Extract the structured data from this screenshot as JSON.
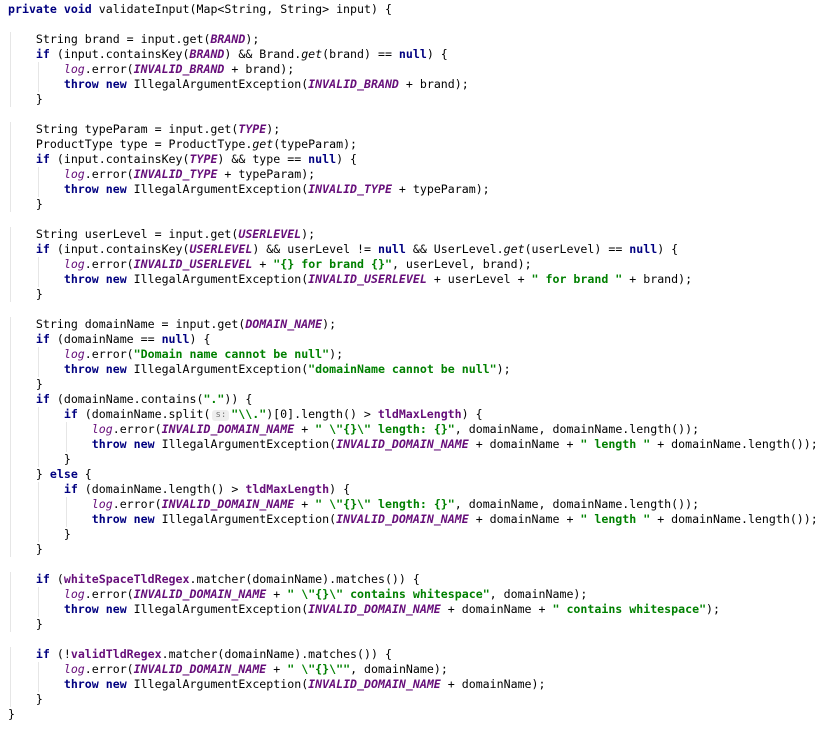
{
  "editor": {
    "lines": [
      {
        "indent": 0,
        "tokens": [
          [
            "kw",
            "private"
          ],
          [
            "t",
            " "
          ],
          [
            "kw",
            "void"
          ],
          [
            "t",
            " validateInput(Map<String, String> input) {"
          ]
        ]
      },
      {
        "indent": 0,
        "tokens": []
      },
      {
        "indent": 1,
        "tokens": [
          [
            "t",
            "String brand = input.get("
          ],
          [
            "fld",
            "BRAND"
          ],
          [
            "t",
            ");"
          ]
        ]
      },
      {
        "indent": 1,
        "tokens": [
          [
            "kw",
            "if"
          ],
          [
            "t",
            " (input.containsKey("
          ],
          [
            "fld",
            "BRAND"
          ],
          [
            "t",
            ") && Brand."
          ],
          [
            "smeth",
            "get"
          ],
          [
            "t",
            "(brand) == "
          ],
          [
            "kw",
            "null"
          ],
          [
            "t",
            ") {"
          ]
        ]
      },
      {
        "indent": 2,
        "tokens": [
          [
            "static",
            "log"
          ],
          [
            "t",
            ".error("
          ],
          [
            "fld",
            "INVALID_BRAND"
          ],
          [
            "t",
            " + brand);"
          ]
        ]
      },
      {
        "indent": 2,
        "tokens": [
          [
            "kw",
            "throw"
          ],
          [
            "t",
            " "
          ],
          [
            "kw",
            "new"
          ],
          [
            "t",
            " IllegalArgumentException("
          ],
          [
            "fld",
            "INVALID_BRAND"
          ],
          [
            "t",
            " + brand);"
          ]
        ]
      },
      {
        "indent": 1,
        "tokens": [
          [
            "t",
            "}"
          ]
        ]
      },
      {
        "indent": 0,
        "tokens": []
      },
      {
        "indent": 1,
        "tokens": [
          [
            "t",
            "String typeParam = input.get("
          ],
          [
            "fld",
            "TYPE"
          ],
          [
            "t",
            ");"
          ]
        ]
      },
      {
        "indent": 1,
        "tokens": [
          [
            "t",
            "ProductType type = ProductType."
          ],
          [
            "smeth",
            "get"
          ],
          [
            "t",
            "(typeParam);"
          ]
        ]
      },
      {
        "indent": 1,
        "tokens": [
          [
            "kw",
            "if"
          ],
          [
            "t",
            " (input.containsKey("
          ],
          [
            "fld",
            "TYPE"
          ],
          [
            "t",
            ") && type == "
          ],
          [
            "kw",
            "null"
          ],
          [
            "t",
            ") {"
          ]
        ]
      },
      {
        "indent": 2,
        "tokens": [
          [
            "static",
            "log"
          ],
          [
            "t",
            ".error("
          ],
          [
            "fld",
            "INVALID_TYPE"
          ],
          [
            "t",
            " + typeParam);"
          ]
        ]
      },
      {
        "indent": 2,
        "tokens": [
          [
            "kw",
            "throw"
          ],
          [
            "t",
            " "
          ],
          [
            "kw",
            "new"
          ],
          [
            "t",
            " IllegalArgumentException("
          ],
          [
            "fld",
            "INVALID_TYPE"
          ],
          [
            "t",
            " + typeParam);"
          ]
        ]
      },
      {
        "indent": 1,
        "tokens": [
          [
            "t",
            "}"
          ]
        ]
      },
      {
        "indent": 0,
        "tokens": []
      },
      {
        "indent": 1,
        "tokens": [
          [
            "t",
            "String userLevel = input.get("
          ],
          [
            "fld",
            "USERLEVEL"
          ],
          [
            "t",
            ");"
          ]
        ]
      },
      {
        "indent": 1,
        "tokens": [
          [
            "kw",
            "if"
          ],
          [
            "t",
            " (input.containsKey("
          ],
          [
            "fld",
            "USERLEVEL"
          ],
          [
            "t",
            ") && userLevel != "
          ],
          [
            "kw",
            "null"
          ],
          [
            "t",
            " && UserLevel."
          ],
          [
            "smeth",
            "get"
          ],
          [
            "t",
            "(userLevel) == "
          ],
          [
            "kw",
            "null"
          ],
          [
            "t",
            ") {"
          ]
        ]
      },
      {
        "indent": 2,
        "tokens": [
          [
            "static",
            "log"
          ],
          [
            "t",
            ".error("
          ],
          [
            "fld",
            "INVALID_USERLEVEL"
          ],
          [
            "t",
            " + "
          ],
          [
            "str",
            "\"{} for brand {}\""
          ],
          [
            "t",
            ", userLevel, brand);"
          ]
        ]
      },
      {
        "indent": 2,
        "tokens": [
          [
            "kw",
            "throw"
          ],
          [
            "t",
            " "
          ],
          [
            "kw",
            "new"
          ],
          [
            "t",
            " IllegalArgumentException("
          ],
          [
            "fld",
            "INVALID_USERLEVEL"
          ],
          [
            "t",
            " + userLevel + "
          ],
          [
            "str",
            "\" for brand \""
          ],
          [
            "t",
            " + brand);"
          ]
        ]
      },
      {
        "indent": 1,
        "tokens": [
          [
            "t",
            "}"
          ]
        ]
      },
      {
        "indent": 0,
        "tokens": []
      },
      {
        "indent": 1,
        "tokens": [
          [
            "t",
            "String domainName = input.get("
          ],
          [
            "fld",
            "DOMAIN_NAME"
          ],
          [
            "t",
            ");"
          ]
        ]
      },
      {
        "indent": 1,
        "tokens": [
          [
            "kw",
            "if"
          ],
          [
            "t",
            " (domainName == "
          ],
          [
            "kw",
            "null"
          ],
          [
            "t",
            ") {"
          ]
        ]
      },
      {
        "indent": 2,
        "tokens": [
          [
            "static",
            "log"
          ],
          [
            "t",
            ".error("
          ],
          [
            "str",
            "\"Domain name cannot be null\""
          ],
          [
            "t",
            ");"
          ]
        ]
      },
      {
        "indent": 2,
        "tokens": [
          [
            "kw",
            "throw"
          ],
          [
            "t",
            " "
          ],
          [
            "kw",
            "new"
          ],
          [
            "t",
            " IllegalArgumentException("
          ],
          [
            "str",
            "\"domainName cannot be null\""
          ],
          [
            "t",
            ");"
          ]
        ]
      },
      {
        "indent": 1,
        "tokens": [
          [
            "t",
            "}"
          ]
        ]
      },
      {
        "indent": 1,
        "tokens": [
          [
            "kw",
            "if"
          ],
          [
            "t",
            " (domainName.contains("
          ],
          [
            "str",
            "\".\""
          ],
          [
            "t",
            ")) {"
          ]
        ]
      },
      {
        "indent": 2,
        "tokens": [
          [
            "kw",
            "if"
          ],
          [
            "t",
            " (domainName.split("
          ],
          [
            "hint",
            "s:"
          ],
          [
            "str",
            "\"\\\\.\""
          ],
          [
            "t",
            ")[0].length() > "
          ],
          [
            "ifld",
            "tldMaxLength"
          ],
          [
            "t",
            ") {"
          ]
        ]
      },
      {
        "indent": 3,
        "tokens": [
          [
            "static",
            "log"
          ],
          [
            "t",
            ".error("
          ],
          [
            "fld",
            "INVALID_DOMAIN_NAME"
          ],
          [
            "t",
            " + "
          ],
          [
            "str",
            "\" \\\"{}\\\" length: {}\""
          ],
          [
            "t",
            ", domainName, domainName.length());"
          ]
        ]
      },
      {
        "indent": 3,
        "tokens": [
          [
            "kw",
            "throw"
          ],
          [
            "t",
            " "
          ],
          [
            "kw",
            "new"
          ],
          [
            "t",
            " IllegalArgumentException("
          ],
          [
            "fld",
            "INVALID_DOMAIN_NAME"
          ],
          [
            "t",
            " + domainName + "
          ],
          [
            "str",
            "\" length \""
          ],
          [
            "t",
            " + domainName.length());"
          ]
        ]
      },
      {
        "indent": 2,
        "tokens": [
          [
            "t",
            "}"
          ]
        ]
      },
      {
        "indent": 1,
        "tokens": [
          [
            "t",
            "} "
          ],
          [
            "kw",
            "else"
          ],
          [
            "t",
            " {"
          ]
        ]
      },
      {
        "indent": 2,
        "tokens": [
          [
            "kw",
            "if"
          ],
          [
            "t",
            " (domainName.length() > "
          ],
          [
            "ifld",
            "tldMaxLength"
          ],
          [
            "t",
            ") {"
          ]
        ]
      },
      {
        "indent": 3,
        "tokens": [
          [
            "static",
            "log"
          ],
          [
            "t",
            ".error("
          ],
          [
            "fld",
            "INVALID_DOMAIN_NAME"
          ],
          [
            "t",
            " + "
          ],
          [
            "str",
            "\" \\\"{}\\\" length: {}\""
          ],
          [
            "t",
            ", domainName, domainName.length());"
          ]
        ]
      },
      {
        "indent": 3,
        "tokens": [
          [
            "kw",
            "throw"
          ],
          [
            "t",
            " "
          ],
          [
            "kw",
            "new"
          ],
          [
            "t",
            " IllegalArgumentException("
          ],
          [
            "fld",
            "INVALID_DOMAIN_NAME"
          ],
          [
            "t",
            " + domainName + "
          ],
          [
            "str",
            "\" length \""
          ],
          [
            "t",
            " + domainName.length());"
          ]
        ]
      },
      {
        "indent": 2,
        "tokens": [
          [
            "t",
            "}"
          ]
        ]
      },
      {
        "indent": 1,
        "tokens": [
          [
            "t",
            "}"
          ]
        ]
      },
      {
        "indent": 0,
        "tokens": []
      },
      {
        "indent": 1,
        "tokens": [
          [
            "kw",
            "if"
          ],
          [
            "t",
            " ("
          ],
          [
            "ifld",
            "whiteSpaceTldRegex"
          ],
          [
            "t",
            ".matcher(domainName).matches()) {"
          ]
        ]
      },
      {
        "indent": 2,
        "tokens": [
          [
            "static",
            "log"
          ],
          [
            "t",
            ".error("
          ],
          [
            "fld",
            "INVALID_DOMAIN_NAME"
          ],
          [
            "t",
            " + "
          ],
          [
            "str",
            "\" \\\"{}\\\" contains whitespace\""
          ],
          [
            "t",
            ", domainName);"
          ]
        ]
      },
      {
        "indent": 2,
        "tokens": [
          [
            "kw",
            "throw"
          ],
          [
            "t",
            " "
          ],
          [
            "kw",
            "new"
          ],
          [
            "t",
            " IllegalArgumentException("
          ],
          [
            "fld",
            "INVALID_DOMAIN_NAME"
          ],
          [
            "t",
            " + domainName + "
          ],
          [
            "str",
            "\" contains whitespace\""
          ],
          [
            "t",
            ");"
          ]
        ]
      },
      {
        "indent": 1,
        "tokens": [
          [
            "t",
            "}"
          ]
        ]
      },
      {
        "indent": 0,
        "tokens": []
      },
      {
        "indent": 1,
        "tokens": [
          [
            "kw",
            "if"
          ],
          [
            "t",
            " (!"
          ],
          [
            "ifld",
            "validTldRegex"
          ],
          [
            "t",
            ".matcher(domainName).matches()) {"
          ]
        ]
      },
      {
        "indent": 2,
        "tokens": [
          [
            "static",
            "log"
          ],
          [
            "t",
            ".error("
          ],
          [
            "fld",
            "INVALID_DOMAIN_NAME"
          ],
          [
            "t",
            " + "
          ],
          [
            "str",
            "\" \\\"{}\\\"\""
          ],
          [
            "t",
            ", domainName);"
          ]
        ]
      },
      {
        "indent": 2,
        "tokens": [
          [
            "kw",
            "throw"
          ],
          [
            "t",
            " "
          ],
          [
            "kw",
            "new"
          ],
          [
            "t",
            " IllegalArgumentException("
          ],
          [
            "fld",
            "INVALID_DOMAIN_NAME"
          ],
          [
            "t",
            " + domainName);"
          ]
        ]
      },
      {
        "indent": 1,
        "tokens": [
          [
            "t",
            "}"
          ]
        ]
      },
      {
        "indent": 0,
        "tokens": [
          [
            "t",
            "}"
          ]
        ]
      }
    ]
  }
}
